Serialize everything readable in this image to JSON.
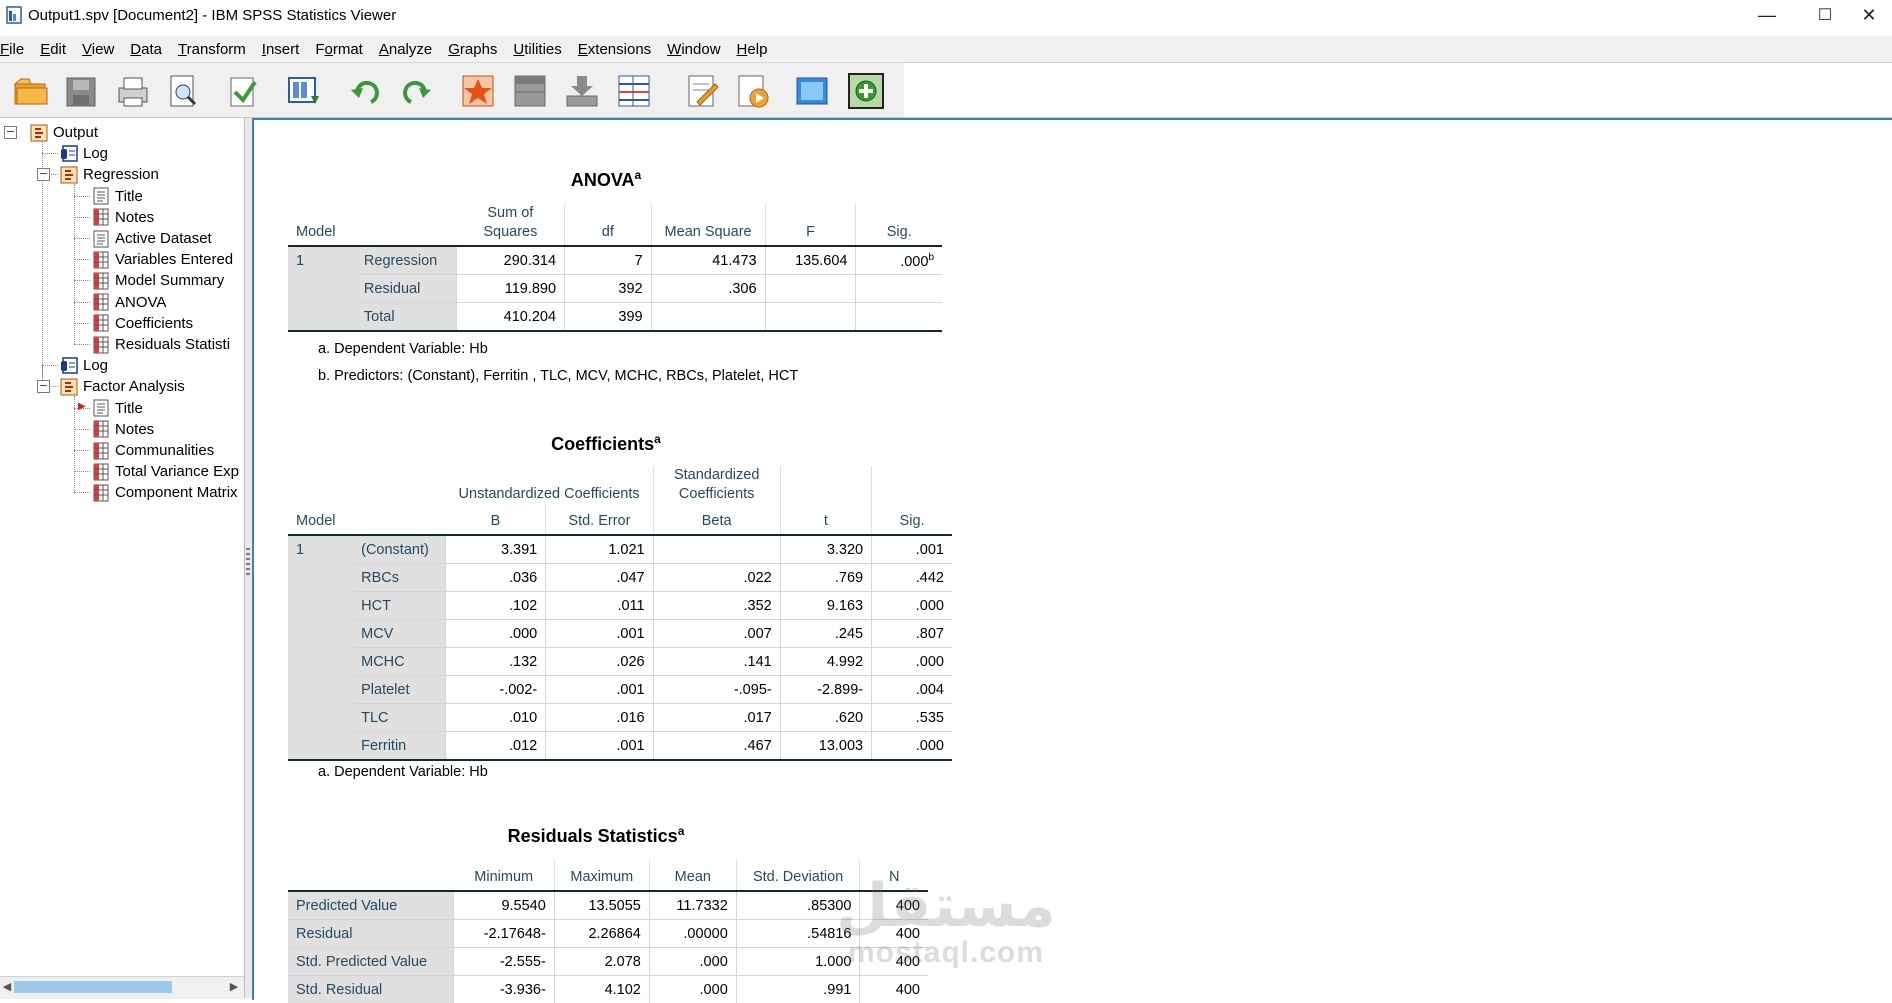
{
  "window": {
    "title": "Output1.spv [Document2] - IBM SPSS Statistics Viewer",
    "controls": {
      "minimize": "—",
      "maximize": "☐",
      "close": "✕"
    }
  },
  "menu": [
    {
      "pre": "",
      "key": "F",
      "post": "ile"
    },
    {
      "pre": "",
      "key": "E",
      "post": "dit"
    },
    {
      "pre": "",
      "key": "V",
      "post": "iew"
    },
    {
      "pre": "",
      "key": "D",
      "post": "ata"
    },
    {
      "pre": "",
      "key": "T",
      "post": "ransform"
    },
    {
      "pre": "",
      "key": "I",
      "post": "nsert"
    },
    {
      "pre": "F",
      "key": "o",
      "post": "rmat"
    },
    {
      "pre": "",
      "key": "A",
      "post": "nalyze"
    },
    {
      "pre": "",
      "key": "G",
      "post": "raphs"
    },
    {
      "pre": "",
      "key": "U",
      "post": "tilities"
    },
    {
      "pre": "",
      "key": "E",
      "post": "xtensions"
    },
    {
      "pre": "",
      "key": "W",
      "post": "indow"
    },
    {
      "pre": "",
      "key": "H",
      "post": "elp"
    }
  ],
  "toolbar": [
    "open-folder-icon",
    "save-icon",
    "print-icon",
    "print-preview-icon",
    "export-icon",
    "recall-dialog-icon",
    "undo-icon",
    "redo-icon",
    "goto-data-icon",
    "goto-case-icon",
    "goto-variable-icon",
    "variables-icon",
    "output-designate-icon",
    "script-icon",
    "fullscreen-icon",
    "add-extension-icon"
  ],
  "outline": {
    "root": "Output",
    "log1": "Log",
    "regression": {
      "label": "Regression",
      "items": [
        "Title",
        "Notes",
        "Active Dataset",
        "Variables Entered",
        "Model Summary",
        "ANOVA",
        "Coefficients",
        "Residuals Statisti"
      ]
    },
    "log2": "Log",
    "factor": {
      "label": "Factor Analysis",
      "items": [
        "Title",
        "Notes",
        "Communalities",
        "Total Variance Exp",
        "Component Matrix"
      ]
    }
  },
  "anova": {
    "title": "ANOVA",
    "title_sup": "a",
    "headers": {
      "model": "Model",
      "ss": "Sum of\nSquares",
      "df": "df",
      "ms": "Mean Square",
      "f": "F",
      "sig": "Sig."
    },
    "model": "1",
    "rows": [
      {
        "label": "Regression",
        "ss": "290.314",
        "df": "7",
        "ms": "41.473",
        "f": "135.604",
        "sig": ".000",
        "sig_sup": "b"
      },
      {
        "label": "Residual",
        "ss": "119.890",
        "df": "392",
        "ms": ".306",
        "f": "",
        "sig": "",
        "sig_sup": ""
      },
      {
        "label": "Total",
        "ss": "410.204",
        "df": "399",
        "ms": "",
        "f": "",
        "sig": "",
        "sig_sup": ""
      }
    ],
    "footnotes": [
      "a. Dependent Variable: Hb",
      "b. Predictors: (Constant), Ferritin , TLC, MCV, MCHC, RBCs, Platelet, HCT"
    ]
  },
  "coefficients": {
    "title": "Coefficients",
    "title_sup": "a",
    "headers": {
      "unstd": "Unstandardized Coefficients",
      "std": "Standardized\nCoefficients",
      "model": "Model",
      "b": "B",
      "se": "Std. Error",
      "beta": "Beta",
      "t": "t",
      "sig": "Sig."
    },
    "model": "1",
    "rows": [
      {
        "label": "(Constant)",
        "b": "3.391",
        "se": "1.021",
        "beta": "",
        "t": "3.320",
        "sig": ".001"
      },
      {
        "label": "RBCs",
        "b": ".036",
        "se": ".047",
        "beta": ".022",
        "t": ".769",
        "sig": ".442"
      },
      {
        "label": "HCT",
        "b": ".102",
        "se": ".011",
        "beta": ".352",
        "t": "9.163",
        "sig": ".000"
      },
      {
        "label": "MCV",
        "b": ".000",
        "se": ".001",
        "beta": ".007",
        "t": ".245",
        "sig": ".807"
      },
      {
        "label": "MCHC",
        "b": ".132",
        "se": ".026",
        "beta": ".141",
        "t": "4.992",
        "sig": ".000"
      },
      {
        "label": "Platelet",
        "b": "-.002-",
        "se": ".001",
        "beta": "-.095-",
        "t": "-2.899-",
        "sig": ".004"
      },
      {
        "label": "TLC",
        "b": ".010",
        "se": ".016",
        "beta": ".017",
        "t": ".620",
        "sig": ".535"
      },
      {
        "label": "Ferritin",
        "b": ".012",
        "se": ".001",
        "beta": ".467",
        "t": "13.003",
        "sig": ".000"
      }
    ],
    "footnotes": [
      "a. Dependent Variable: Hb"
    ]
  },
  "residuals": {
    "title": "Residuals Statistics",
    "title_sup": "a",
    "headers": {
      "min": "Minimum",
      "max": "Maximum",
      "mean": "Mean",
      "sd": "Std. Deviation",
      "n": "N"
    },
    "rows": [
      {
        "label": "Predicted Value",
        "min": "9.5540",
        "max": "13.5055",
        "mean": "11.7332",
        "sd": ".85300",
        "n": "400"
      },
      {
        "label": "Residual",
        "min": "-2.17648-",
        "max": "2.26864",
        "mean": ".00000",
        "sd": ".54816",
        "n": "400"
      },
      {
        "label": "Std. Predicted Value",
        "min": "-2.555-",
        "max": "2.078",
        "mean": ".000",
        "sd": "1.000",
        "n": "400"
      },
      {
        "label": "Std. Residual",
        "min": "-3.936-",
        "max": "4.102",
        "mean": ".000",
        "sd": ".991",
        "n": "400"
      }
    ]
  },
  "watermark": {
    "arabic": "مستقل",
    "latin": "mostaql.com"
  }
}
